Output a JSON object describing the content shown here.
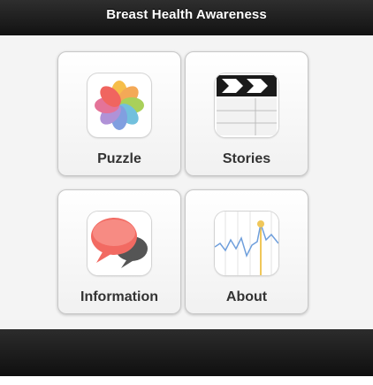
{
  "header": {
    "title": "Breast Health Awareness"
  },
  "tiles": [
    {
      "label": "Puzzle",
      "icon": "photos-flower-icon"
    },
    {
      "label": "Stories",
      "icon": "clapperboard-icon"
    },
    {
      "label": "Information",
      "icon": "speech-bubbles-icon"
    },
    {
      "label": "About",
      "icon": "stocks-chart-icon"
    }
  ],
  "colors": {
    "header_bg": "#1e1e1e",
    "content_bg": "#f4f4f4",
    "tile_bg": "#ffffff",
    "label": "#333333"
  }
}
